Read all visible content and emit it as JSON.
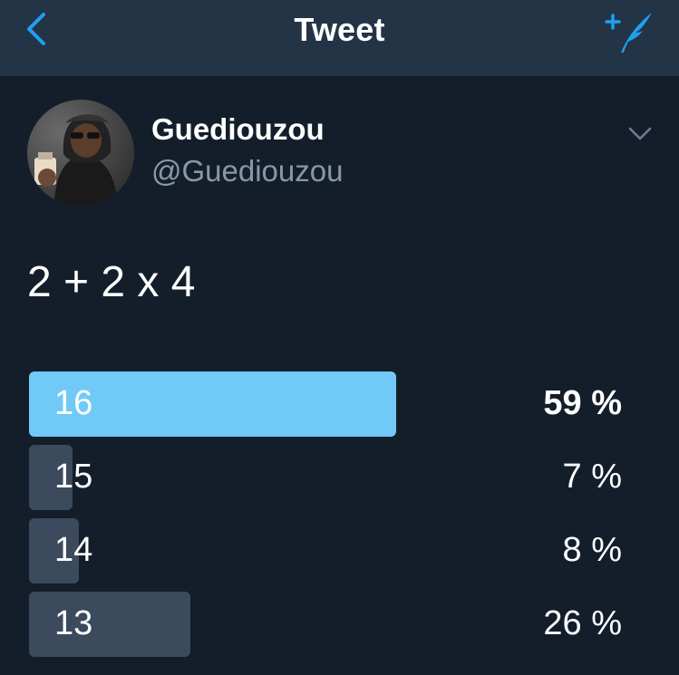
{
  "header": {
    "title": "Tweet",
    "back_icon": "chevron-left-icon",
    "compose_icon": "compose-quill-icon",
    "accent_color": "#1da1f2"
  },
  "tweet": {
    "author": {
      "name": "Guediouzou",
      "handle": "@Guediouzou"
    },
    "text": "2 + 2 x 4",
    "poll": {
      "options": [
        {
          "label": "16",
          "percent_text": "59 %",
          "percent": 59,
          "winner": true
        },
        {
          "label": "15",
          "percent_text": "7 %",
          "percent": 7,
          "winner": false
        },
        {
          "label": "14",
          "percent_text": "8 %",
          "percent": 8,
          "winner": false
        },
        {
          "label": "13",
          "percent_text": "26 %",
          "percent": 26,
          "winner": false
        }
      ],
      "winner_color": "#71c9f8",
      "bar_color": "#3b4a5c"
    }
  }
}
